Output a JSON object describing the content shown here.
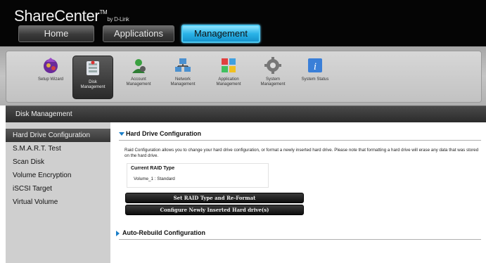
{
  "brand": {
    "name": "ShareCenter",
    "tm": "TM",
    "by": "by D-Link"
  },
  "nav": {
    "home": "Home",
    "applications": "Applications",
    "management": "Management"
  },
  "toolbar": {
    "setup_wizard": "Setup Wizard",
    "disk_1": "Disk",
    "disk_2": "Management",
    "account_1": "Account",
    "account_2": "Management",
    "network_1": "Network",
    "network_2": "Management",
    "application_1": "Application",
    "application_2": "Management",
    "system_1": "System",
    "system_2": "Management",
    "status": "System Status"
  },
  "section": {
    "title": "Disk Management"
  },
  "sidebar": {
    "items": [
      {
        "label": "Hard Drive Configuration"
      },
      {
        "label": "S.M.A.R.T. Test"
      },
      {
        "label": "Scan Disk"
      },
      {
        "label": "Volume Encryption"
      },
      {
        "label": "iSCSI Target"
      },
      {
        "label": "Virtual Volume"
      }
    ]
  },
  "main": {
    "hd_title": "Hard Drive Configuration",
    "description": "Raid Configuration allows you to change your hard drive configuration, or format a newly inserted hard drive. Please note that formatting a hard drive will erase any data that was stored on the hard drive.",
    "raid_label": "Current RAID Type",
    "raid_value": "Volume_1 : Standard",
    "btn_raid": "Set RAID Type and Re-Format",
    "btn_configure": "Configure Newly Inserted Hard drive(s)",
    "auto_title": "Auto-Rebuild Configuration"
  },
  "colors": {
    "accent": "#2ab3e8",
    "link_triangle": "#1a7ec8"
  }
}
